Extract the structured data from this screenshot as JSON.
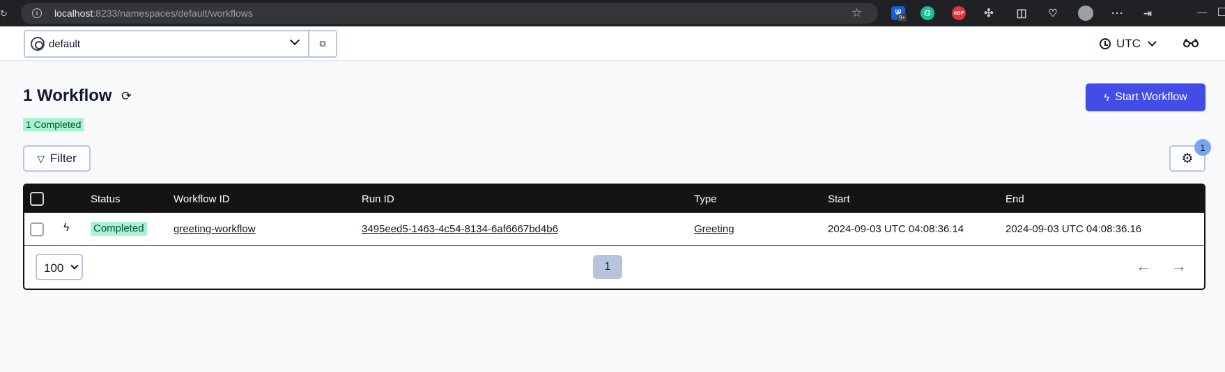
{
  "browser": {
    "url_host": "localhost",
    "url_path": ":8233/namespaces/default/workflows",
    "ext_badge": "9+",
    "ext_grammarly": "G",
    "ext_abp": "ABP"
  },
  "header": {
    "namespace": "default",
    "timezone": "UTC"
  },
  "main": {
    "title": "1 Workflow",
    "status_count": "1 Completed",
    "start_button_label": "Start Workflow",
    "filter_label": "Filter",
    "settings_badge": "1"
  },
  "table": {
    "columns": [
      "Status",
      "Workflow ID",
      "Run ID",
      "Type",
      "Start",
      "End"
    ],
    "rows": [
      {
        "status": "Completed",
        "workflow_id": "greeting-workflow",
        "run_id": "3495eed5-1463-4c54-8134-6af6667bd4b6",
        "type": "Greeting",
        "start": "2024-09-03 UTC 04:08:36.14",
        "end": "2024-09-03 UTC 04:08:36.16"
      }
    ]
  },
  "pagination": {
    "page_size": "100",
    "current_page": "1"
  },
  "colors": {
    "accent": "#444ce7",
    "completed_bg": "#a7f3d0",
    "header_bg": "#141414"
  }
}
